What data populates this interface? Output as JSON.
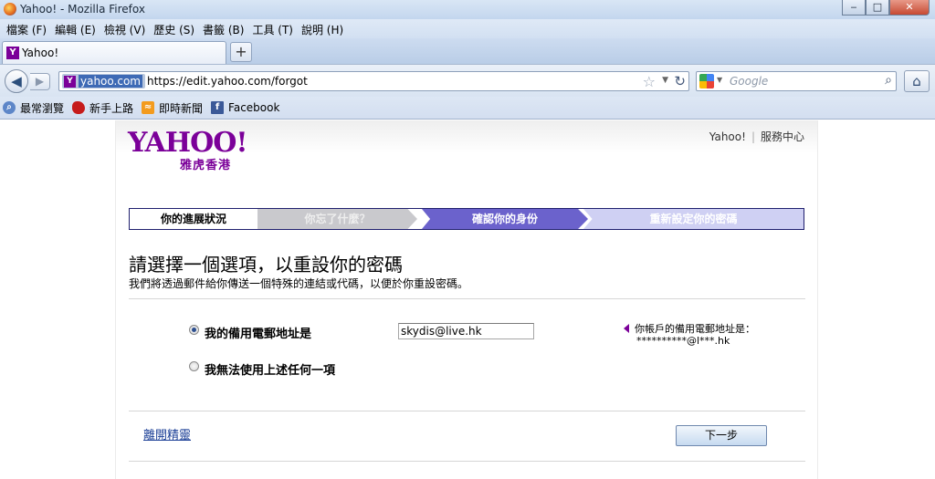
{
  "window": {
    "title": "Yahoo! - Mozilla Firefox",
    "min": "‒",
    "max": "□",
    "close": "✕"
  },
  "menu": [
    "檔案 (F)",
    "編輯 (E)",
    "檢視 (V)",
    "歷史 (S)",
    "書籤 (B)",
    "工具 (T)",
    "說明 (H)"
  ],
  "tab": {
    "label": "Yahoo!",
    "new_tab": "+"
  },
  "nav": {
    "site_identity": "yahoo.com",
    "url": "https://edit.yahoo.com/forgot",
    "search_placeholder": "Google"
  },
  "bookmarks": [
    "最常瀏覽",
    "新手上路",
    "即時新聞",
    "Facebook"
  ],
  "page": {
    "logo_text": "YAHOO!",
    "logo_sub": "雅虎香港",
    "top_links": [
      "Yahoo!",
      "服務中心"
    ],
    "progress_steps": [
      "你的進展狀況",
      "你忘了什麼？",
      "確認你的身份",
      "重新設定你的密碼"
    ],
    "heading": "請選擇一個選項，以重設你的密碼",
    "description": "我們將透過郵件給你傳送一個特殊的連結或代碼，以便於你重設密碼。",
    "options": [
      {
        "label": "我的備用電郵地址是",
        "selected": true
      },
      {
        "label": "我無法使用上述任何一項",
        "selected": false
      }
    ],
    "email_value": "skydis@live.hk",
    "hint_title": "你帳戶的備用電郵地址是：",
    "hint_value": "**********@l***.hk",
    "exit_link": "離開精靈",
    "next_button": "下一步"
  },
  "colors": {
    "brand": "#7b0099",
    "active_step": "#6b62cc",
    "link": "#1b3f96"
  }
}
